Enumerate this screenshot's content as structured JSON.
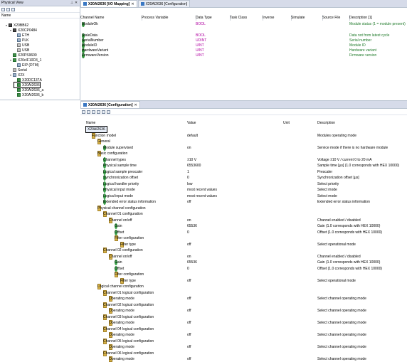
{
  "physical_view": {
    "title": "Physical View",
    "column_name": "Name",
    "tree": [
      {
        "label": "X20BB62",
        "depth": 1,
        "icon": "cpu-icon",
        "expander": "▾"
      },
      {
        "label": "X20CP0484",
        "depth": 2,
        "icon": "cpu-icon",
        "expander": "▾"
      },
      {
        "label": "ETH",
        "depth": 3,
        "icon": "network-icon",
        "expander": ""
      },
      {
        "label": "PLK",
        "depth": 3,
        "icon": "network-icon",
        "expander": ""
      },
      {
        "label": "USB",
        "depth": 3,
        "icon": "usb-icon",
        "expander": ""
      },
      {
        "label": "USB",
        "depth": 3,
        "icon": "usb-icon",
        "expander": ""
      },
      {
        "label": "X20PS9600",
        "depth": 2,
        "icon": "io-module-icon",
        "expander": ""
      },
      {
        "label": "X20cIF10D3_1",
        "depth": 2,
        "icon": "io-module-icon",
        "expander": "▾"
      },
      {
        "label": "EIP (DTM)",
        "depth": 3,
        "icon": "network-icon",
        "expander": ""
      },
      {
        "label": "Serial",
        "depth": 2,
        "icon": "serial-icon",
        "expander": ""
      },
      {
        "label": "X2X",
        "depth": 2,
        "icon": "network-icon",
        "expander": "▾"
      },
      {
        "label": "X20DC137A",
        "depth": 3,
        "icon": "io-module-icon",
        "expander": ""
      },
      {
        "label": "X20AI2636",
        "depth": 3,
        "icon": "io-module-icon",
        "expander": "",
        "selected": true
      },
      {
        "label": "X20AI2636_a",
        "depth": 3,
        "icon": "io-module-icon",
        "expander": ""
      },
      {
        "label": "X20AI2636_b",
        "depth": 3,
        "icon": "io-module-icon",
        "expander": ""
      }
    ]
  },
  "top_tabs": [
    {
      "label": "X20AI2636 [I/O Mapping]",
      "active": true
    },
    {
      "label": "X20AI2636 [Configuration]",
      "active": false
    }
  ],
  "io_mapping": {
    "columns": [
      "Channel Name",
      "Process Variable",
      "Data Type",
      "Task Class",
      "Inverse",
      "Simulate",
      "Source File",
      "Description [1]"
    ],
    "rows": [
      {
        "name": "ModuleOk",
        "type": "BOOL",
        "desc": "Module status (1 = module present)",
        "desc_color": "green"
      },
      {
        "name": "StaleData",
        "type": "BOOL",
        "desc": "Data not from latest cycle",
        "desc_color": "green"
      },
      {
        "name": "SerialNumber",
        "type": "UDINT",
        "desc": "Serial number",
        "desc_color": "green"
      },
      {
        "name": "ModuleID",
        "type": "UINT",
        "desc": "Module ID",
        "desc_color": "green"
      },
      {
        "name": "HardwareVariant",
        "type": "UINT",
        "desc": "Hardware variant",
        "desc_color": "green"
      },
      {
        "name": "FirmwareVersion",
        "type": "UINT",
        "desc": "Firmware version",
        "desc_color": "green"
      }
    ]
  },
  "config": {
    "tab_label": "X20AI2636 [Configuration]",
    "columns": [
      "Name",
      "Value",
      "Unit",
      "Description"
    ],
    "rows": [
      {
        "name": "X20AI2636",
        "value": "",
        "desc": "",
        "depth": 0,
        "kind": "root",
        "exp": "▾",
        "selected": true
      },
      {
        "name": "Function model",
        "value": "default",
        "desc": "Modules operating mode",
        "depth": 1,
        "kind": "folder",
        "exp": "▾"
      },
      {
        "name": "General",
        "value": "",
        "desc": "",
        "depth": 2,
        "kind": "folder",
        "exp": "▾"
      },
      {
        "name": "Module supervised",
        "value": "on",
        "desc": "Service mode if there is no hardware module",
        "depth": 3,
        "kind": "leaf",
        "exp": ""
      },
      {
        "name": "Basic configuration",
        "value": "",
        "desc": "",
        "depth": 2,
        "kind": "folder",
        "exp": "▾"
      },
      {
        "name": "Channel types",
        "value": "±10 V",
        "desc": "Voltage ±10 V / current 0 to 20 mA",
        "depth": 3,
        "kind": "leaf",
        "exp": ""
      },
      {
        "name": "Physical sample time",
        "value": "6553600",
        "desc": "Sample time [µs] (1.0 corresponds with HEX 10000)",
        "depth": 3,
        "kind": "leaf",
        "exp": ""
      },
      {
        "name": "Logical sample prescaler",
        "value": "1",
        "desc": "Prescaler",
        "depth": 3,
        "kind": "leaf",
        "exp": ""
      },
      {
        "name": "Synchronization offset",
        "value": "0",
        "desc": "Synchronization offset [µs]",
        "depth": 3,
        "kind": "leaf",
        "exp": ""
      },
      {
        "name": "Logical handler priority",
        "value": "low",
        "desc": "Select priority",
        "depth": 3,
        "kind": "leaf",
        "exp": ""
      },
      {
        "name": "Physical input mode",
        "value": "most recent values",
        "desc": "Select mode",
        "depth": 3,
        "kind": "leaf",
        "exp": ""
      },
      {
        "name": "Logical input mode",
        "value": "most recent values",
        "desc": "Select mode",
        "depth": 3,
        "kind": "leaf",
        "exp": ""
      },
      {
        "name": "Extended error status information",
        "value": "off",
        "desc": "Extended error status information",
        "depth": 3,
        "kind": "leaf",
        "exp": ""
      },
      {
        "name": "Physical channel configuration",
        "value": "",
        "desc": "",
        "depth": 2,
        "kind": "folder",
        "exp": "▾"
      },
      {
        "name": "Channel 01 configuration",
        "value": "",
        "desc": "",
        "depth": 3,
        "kind": "folder",
        "exp": "▾"
      },
      {
        "name": "Channel on/off",
        "value": "on",
        "desc": "Channel enabled / disabled",
        "depth": 4,
        "kind": "folder",
        "exp": "▾"
      },
      {
        "name": "Gain",
        "value": "65536",
        "desc": "Gain (1.0 corresponds with HEX 10000)",
        "depth": 5,
        "kind": "leaf",
        "exp": ""
      },
      {
        "name": "Offset",
        "value": "0",
        "desc": "Offset (1.0 corresponds with HEX 10000)",
        "depth": 5,
        "kind": "leaf",
        "exp": ""
      },
      {
        "name": "Filter configuration",
        "value": "",
        "desc": "",
        "depth": 5,
        "kind": "folder",
        "exp": "▾"
      },
      {
        "name": "Filter type",
        "value": "off",
        "desc": "Select operational mode",
        "depth": 6,
        "kind": "folder",
        "exp": "›"
      },
      {
        "name": "Channel 02 configuration",
        "value": "",
        "desc": "",
        "depth": 3,
        "kind": "folder",
        "exp": "▾"
      },
      {
        "name": "Channel on/off",
        "value": "on",
        "desc": "Channel enabled / disabled",
        "depth": 4,
        "kind": "folder",
        "exp": "▾"
      },
      {
        "name": "Gain",
        "value": "65536",
        "desc": "Gain (1.0 corresponds with HEX 10000)",
        "depth": 5,
        "kind": "leaf",
        "exp": ""
      },
      {
        "name": "Offset",
        "value": "0",
        "desc": "Offset (1.0 corresponds with HEX 10000)",
        "depth": 5,
        "kind": "leaf",
        "exp": ""
      },
      {
        "name": "Filter configuration",
        "value": "",
        "desc": "",
        "depth": 5,
        "kind": "folder",
        "exp": "▾"
      },
      {
        "name": "Filter type",
        "value": "off",
        "desc": "Select operational mode",
        "depth": 6,
        "kind": "folder",
        "exp": "›"
      },
      {
        "name": "Logical channel configuration",
        "value": "",
        "desc": "",
        "depth": 2,
        "kind": "folder",
        "exp": "▾"
      },
      {
        "name": "Channel 01 logical configuration",
        "value": "",
        "desc": "",
        "depth": 3,
        "kind": "folder",
        "exp": "▾"
      },
      {
        "name": "Operating mode",
        "value": "off",
        "desc": "Select channel operating mode",
        "depth": 4,
        "kind": "folder",
        "exp": "›"
      },
      {
        "name": "Channel 02 logical configuration",
        "value": "",
        "desc": "",
        "depth": 3,
        "kind": "folder",
        "exp": "▾"
      },
      {
        "name": "Operating mode",
        "value": "off",
        "desc": "Select channel operating mode",
        "depth": 4,
        "kind": "folder",
        "exp": "›"
      },
      {
        "name": "Channel 03 logical configuration",
        "value": "",
        "desc": "",
        "depth": 3,
        "kind": "folder",
        "exp": "▾"
      },
      {
        "name": "Operating mode",
        "value": "off",
        "desc": "Select channel operating mode",
        "depth": 4,
        "kind": "folder",
        "exp": "›"
      },
      {
        "name": "Channel 04 logical configuration",
        "value": "",
        "desc": "",
        "depth": 3,
        "kind": "folder",
        "exp": "▾"
      },
      {
        "name": "Operating mode",
        "value": "off",
        "desc": "Select channel operating mode",
        "depth": 4,
        "kind": "folder",
        "exp": "›"
      },
      {
        "name": "Channel 05 logical configuration",
        "value": "",
        "desc": "",
        "depth": 3,
        "kind": "folder",
        "exp": "▾"
      },
      {
        "name": "Operating mode",
        "value": "off",
        "desc": "Select channel operating mode",
        "depth": 4,
        "kind": "folder",
        "exp": "›"
      },
      {
        "name": "Channel 06 logical configuration",
        "value": "",
        "desc": "",
        "depth": 3,
        "kind": "folder",
        "exp": "▾"
      },
      {
        "name": "Operating mode",
        "value": "off",
        "desc": "Select channel operating mode",
        "depth": 4,
        "kind": "folder",
        "exp": "›"
      }
    ]
  },
  "colors": {
    "data_type": "#b000a0",
    "description_green": "#1f7a2a",
    "tab_strip": "#d6dbe9"
  }
}
